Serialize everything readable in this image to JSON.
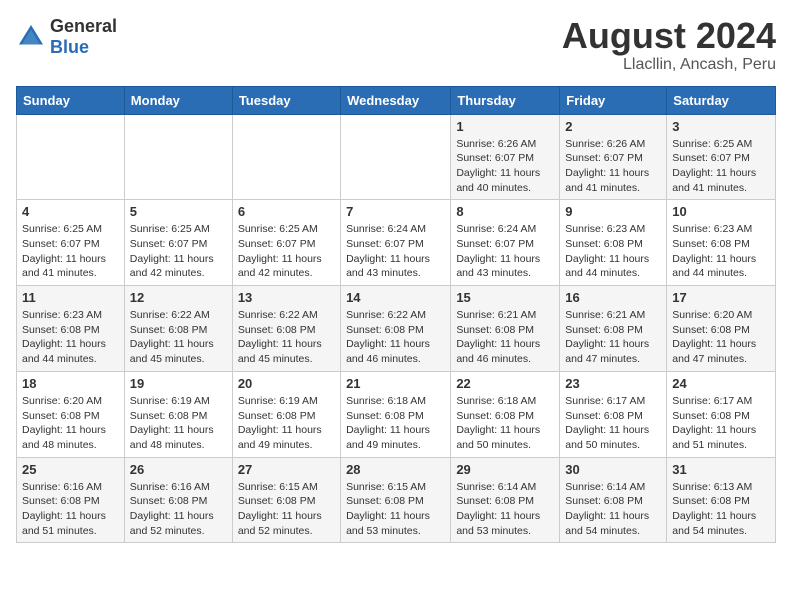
{
  "header": {
    "logo_general": "General",
    "logo_blue": "Blue",
    "title": "August 2024",
    "subtitle": "Llacllin, Ancash, Peru"
  },
  "days_of_week": [
    "Sunday",
    "Monday",
    "Tuesday",
    "Wednesday",
    "Thursday",
    "Friday",
    "Saturday"
  ],
  "weeks": [
    [
      {
        "day": "",
        "info": ""
      },
      {
        "day": "",
        "info": ""
      },
      {
        "day": "",
        "info": ""
      },
      {
        "day": "",
        "info": ""
      },
      {
        "day": "1",
        "info": "Sunrise: 6:26 AM\nSunset: 6:07 PM\nDaylight: 11 hours and 40 minutes."
      },
      {
        "day": "2",
        "info": "Sunrise: 6:26 AM\nSunset: 6:07 PM\nDaylight: 11 hours and 41 minutes."
      },
      {
        "day": "3",
        "info": "Sunrise: 6:25 AM\nSunset: 6:07 PM\nDaylight: 11 hours and 41 minutes."
      }
    ],
    [
      {
        "day": "4",
        "info": "Sunrise: 6:25 AM\nSunset: 6:07 PM\nDaylight: 11 hours and 41 minutes."
      },
      {
        "day": "5",
        "info": "Sunrise: 6:25 AM\nSunset: 6:07 PM\nDaylight: 11 hours and 42 minutes."
      },
      {
        "day": "6",
        "info": "Sunrise: 6:25 AM\nSunset: 6:07 PM\nDaylight: 11 hours and 42 minutes."
      },
      {
        "day": "7",
        "info": "Sunrise: 6:24 AM\nSunset: 6:07 PM\nDaylight: 11 hours and 43 minutes."
      },
      {
        "day": "8",
        "info": "Sunrise: 6:24 AM\nSunset: 6:07 PM\nDaylight: 11 hours and 43 minutes."
      },
      {
        "day": "9",
        "info": "Sunrise: 6:23 AM\nSunset: 6:08 PM\nDaylight: 11 hours and 44 minutes."
      },
      {
        "day": "10",
        "info": "Sunrise: 6:23 AM\nSunset: 6:08 PM\nDaylight: 11 hours and 44 minutes."
      }
    ],
    [
      {
        "day": "11",
        "info": "Sunrise: 6:23 AM\nSunset: 6:08 PM\nDaylight: 11 hours and 44 minutes."
      },
      {
        "day": "12",
        "info": "Sunrise: 6:22 AM\nSunset: 6:08 PM\nDaylight: 11 hours and 45 minutes."
      },
      {
        "day": "13",
        "info": "Sunrise: 6:22 AM\nSunset: 6:08 PM\nDaylight: 11 hours and 45 minutes."
      },
      {
        "day": "14",
        "info": "Sunrise: 6:22 AM\nSunset: 6:08 PM\nDaylight: 11 hours and 46 minutes."
      },
      {
        "day": "15",
        "info": "Sunrise: 6:21 AM\nSunset: 6:08 PM\nDaylight: 11 hours and 46 minutes."
      },
      {
        "day": "16",
        "info": "Sunrise: 6:21 AM\nSunset: 6:08 PM\nDaylight: 11 hours and 47 minutes."
      },
      {
        "day": "17",
        "info": "Sunrise: 6:20 AM\nSunset: 6:08 PM\nDaylight: 11 hours and 47 minutes."
      }
    ],
    [
      {
        "day": "18",
        "info": "Sunrise: 6:20 AM\nSunset: 6:08 PM\nDaylight: 11 hours and 48 minutes."
      },
      {
        "day": "19",
        "info": "Sunrise: 6:19 AM\nSunset: 6:08 PM\nDaylight: 11 hours and 48 minutes."
      },
      {
        "day": "20",
        "info": "Sunrise: 6:19 AM\nSunset: 6:08 PM\nDaylight: 11 hours and 49 minutes."
      },
      {
        "day": "21",
        "info": "Sunrise: 6:18 AM\nSunset: 6:08 PM\nDaylight: 11 hours and 49 minutes."
      },
      {
        "day": "22",
        "info": "Sunrise: 6:18 AM\nSunset: 6:08 PM\nDaylight: 11 hours and 50 minutes."
      },
      {
        "day": "23",
        "info": "Sunrise: 6:17 AM\nSunset: 6:08 PM\nDaylight: 11 hours and 50 minutes."
      },
      {
        "day": "24",
        "info": "Sunrise: 6:17 AM\nSunset: 6:08 PM\nDaylight: 11 hours and 51 minutes."
      }
    ],
    [
      {
        "day": "25",
        "info": "Sunrise: 6:16 AM\nSunset: 6:08 PM\nDaylight: 11 hours and 51 minutes."
      },
      {
        "day": "26",
        "info": "Sunrise: 6:16 AM\nSunset: 6:08 PM\nDaylight: 11 hours and 52 minutes."
      },
      {
        "day": "27",
        "info": "Sunrise: 6:15 AM\nSunset: 6:08 PM\nDaylight: 11 hours and 52 minutes."
      },
      {
        "day": "28",
        "info": "Sunrise: 6:15 AM\nSunset: 6:08 PM\nDaylight: 11 hours and 53 minutes."
      },
      {
        "day": "29",
        "info": "Sunrise: 6:14 AM\nSunset: 6:08 PM\nDaylight: 11 hours and 53 minutes."
      },
      {
        "day": "30",
        "info": "Sunrise: 6:14 AM\nSunset: 6:08 PM\nDaylight: 11 hours and 54 minutes."
      },
      {
        "day": "31",
        "info": "Sunrise: 6:13 AM\nSunset: 6:08 PM\nDaylight: 11 hours and 54 minutes."
      }
    ]
  ]
}
